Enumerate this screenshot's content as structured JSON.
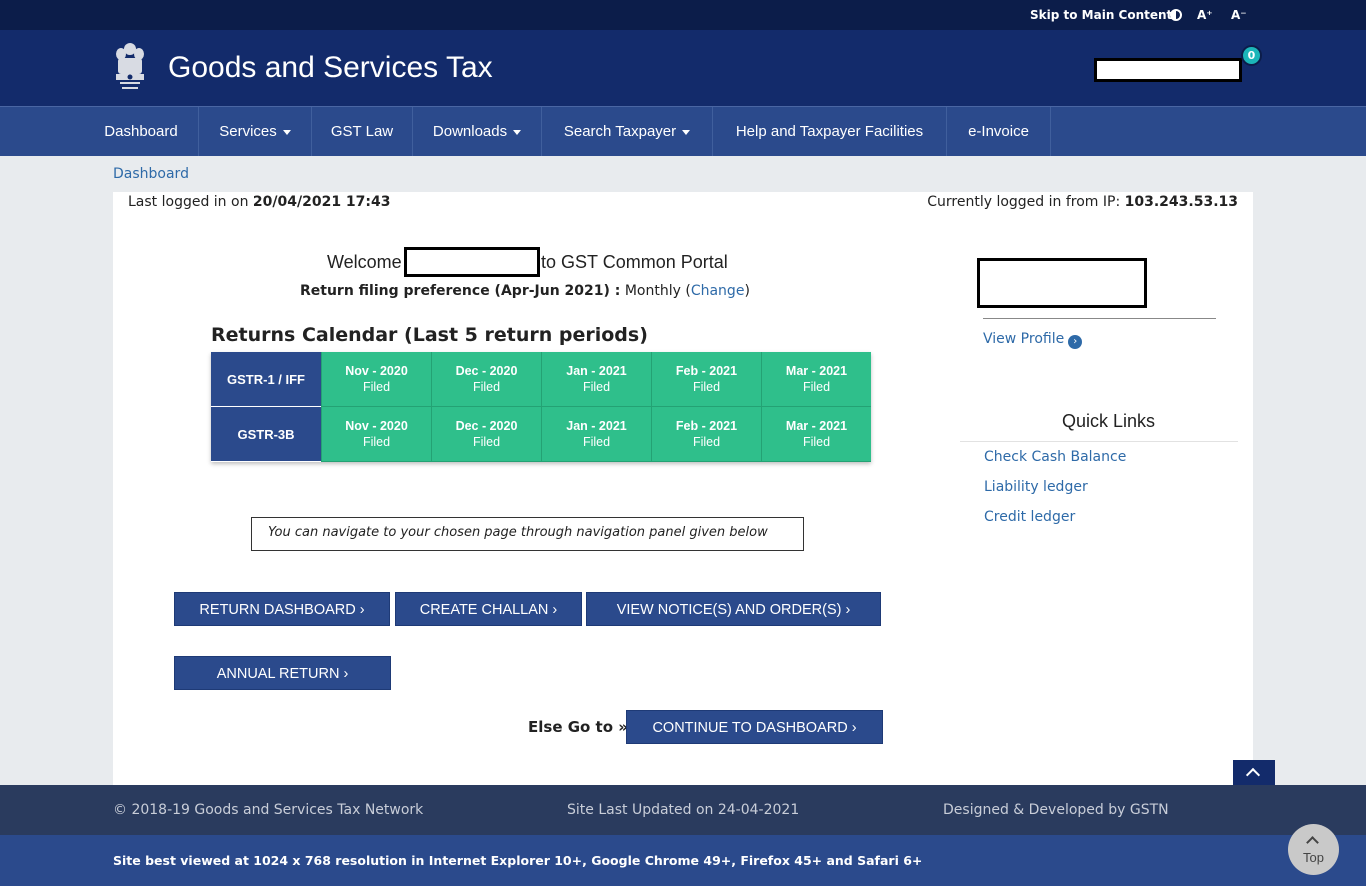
{
  "topbar": {
    "skip_label": "Skip to Main Content",
    "font_increase": "A⁺",
    "font_decrease": "A⁻"
  },
  "header": {
    "site_title": "Goods and Services Tax",
    "notification_count": "0"
  },
  "nav": {
    "items": [
      {
        "label": "Dashboard"
      },
      {
        "label": "Services"
      },
      {
        "label": "GST Law"
      },
      {
        "label": "Downloads"
      },
      {
        "label": "Search Taxpayer"
      },
      {
        "label": "Help and Taxpayer Facilities"
      },
      {
        "label": "e-Invoice"
      }
    ]
  },
  "breadcrumb": "Dashboard",
  "session": {
    "last_login_label": "Last logged in on",
    "last_login_value": "20/04/2021 17:43",
    "ip_label": "Currently logged in from IP:",
    "ip_value": "103.243.53.13"
  },
  "welcome": {
    "prefix": "Welcome",
    "suffix": "to GST Common Portal",
    "pref_label": "Return filing preference (Apr-Jun 2021) :",
    "pref_value": "Monthly",
    "change_open": "(",
    "change_label": "Change",
    "change_close": ")"
  },
  "calendar": {
    "title": "Returns Calendar (Last 5 return periods)",
    "rows": [
      {
        "return": "GSTR-1 / IFF",
        "cells": [
          {
            "period": "Nov - 2020",
            "status": "Filed"
          },
          {
            "period": "Dec - 2020",
            "status": "Filed"
          },
          {
            "period": "Jan - 2021",
            "status": "Filed"
          },
          {
            "period": "Feb - 2021",
            "status": "Filed"
          },
          {
            "period": "Mar - 2021",
            "status": "Filed"
          }
        ]
      },
      {
        "return": "GSTR-3B",
        "cells": [
          {
            "period": "Nov - 2020",
            "status": "Filed"
          },
          {
            "period": "Dec - 2020",
            "status": "Filed"
          },
          {
            "period": "Jan - 2021",
            "status": "Filed"
          },
          {
            "period": "Feb - 2021",
            "status": "Filed"
          },
          {
            "period": "Mar - 2021",
            "status": "Filed"
          }
        ]
      }
    ]
  },
  "info_text": "You can navigate to your chosen page through navigation panel given below",
  "buttons": {
    "return_dashboard": "RETURN DASHBOARD ›",
    "create_challan": "CREATE CHALLAN ›",
    "view_notices": "VIEW NOTICE(S) AND ORDER(S) ›",
    "annual_return": "ANNUAL RETURN ›",
    "else_go_to": "Else Go to »",
    "continue_dashboard": "CONTINUE TO DASHBOARD ›"
  },
  "sidebar": {
    "view_profile": "View Profile",
    "quick_links_title": "Quick Links",
    "quick_links": [
      {
        "label": "Check Cash Balance"
      },
      {
        "label": "Liability ledger"
      },
      {
        "label": "Credit ledger"
      }
    ]
  },
  "footer": {
    "copyright": "© 2018-19 Goods and Services Tax Network",
    "last_updated": "Site Last Updated on 24-04-2021",
    "designed_by": "Designed & Developed by GSTN",
    "best_viewed": "Site best viewed at 1024 x 768 resolution in Internet Explorer 10+, Google Chrome 49+, Firefox 45+ and Safari 6+",
    "top_label": "Top"
  },
  "colors": {
    "top_bar": "#0c1d4a",
    "header": "#132b6b",
    "nav": "#2b4a8c",
    "filed_green": "#2fbf8b",
    "link": "#2e6aa8",
    "badge": "#1cb6b9"
  },
  "icons": {
    "contrast": "contrast-icon",
    "emblem": "national-emblem-icon",
    "view_profile": "chevron-circle-right-icon",
    "scroll_up": "chevron-up-icon"
  }
}
